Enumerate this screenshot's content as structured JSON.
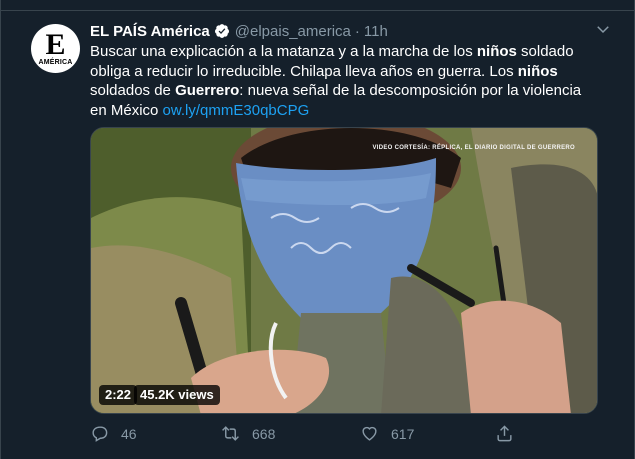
{
  "tweet": {
    "author_name": "EL PAÍS América",
    "handle": "@elpais_america",
    "separator": "·",
    "time": "11h",
    "avatar_letter": "E",
    "avatar_caption": "AMÉRICA",
    "text": {
      "p1": "Buscar una explicación a la matanza y a la marcha de los ",
      "b1": "niños",
      "p2": " soldado obliga a reducir lo irreducible. Chilapa lleva años en guerra. Los ",
      "b2": "niños",
      "p3": " soldados de ",
      "b3": "Guerrero",
      "p4": ": nueva señal de la descomposición por la violencia en México ",
      "link": "ow.ly/qmmE30qbCPG"
    },
    "video": {
      "credit": "VIDEO CORTESÍA: RÉPLICA, EL DIARIO DIGITAL DE GUERRERO",
      "duration": "2:22",
      "views": "45.2K views"
    },
    "actions": {
      "replies": "46",
      "retweets": "668",
      "likes": "617"
    },
    "icons": {
      "verified": "verified-badge-icon",
      "more": "chevron-down-icon",
      "reply": "reply-icon",
      "retweet": "retweet-icon",
      "like": "heart-icon",
      "share": "share-icon"
    },
    "colors": {
      "background": "#15202b",
      "link": "#1da1f2",
      "muted": "#8899a6"
    }
  }
}
